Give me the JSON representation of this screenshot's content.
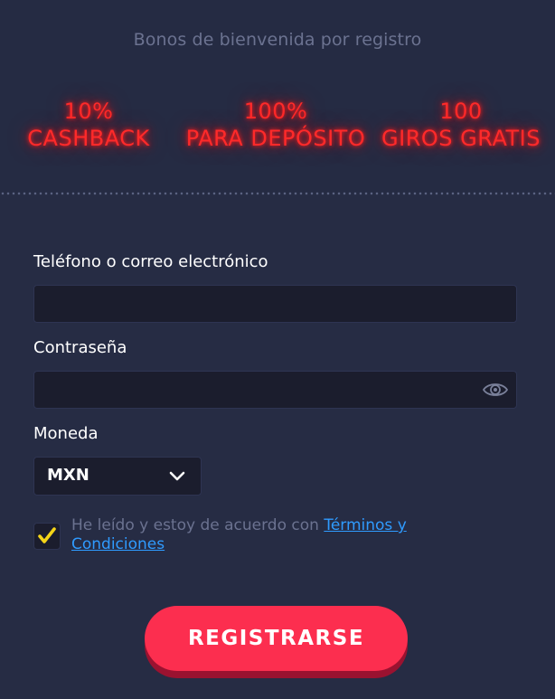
{
  "header": {
    "subtitle": "Bonos de bienvenida por registro"
  },
  "bonuses": [
    {
      "value": "10%",
      "label": "CASHBACK"
    },
    {
      "value": "100%",
      "label": "PARA DEPÓSITO"
    },
    {
      "value": "100",
      "label": "GIROS GRATIS"
    }
  ],
  "form": {
    "contact_label": "Teléfono o correo electrónico",
    "contact_value": "",
    "password_label": "Contraseña",
    "password_value": "",
    "currency_label": "Moneda",
    "currency_selected": "MXN",
    "terms_prefix": "He leído y estoy de acuerdo con ",
    "terms_link": "Términos y Condiciones",
    "terms_checked": true,
    "submit_label": "REGISTRARSE"
  },
  "colors": {
    "background": "#262c44",
    "neon_red": "#ff2a2a",
    "link_blue": "#2f9bff",
    "check_yellow": "#f5d518",
    "button_red": "#fc2e4f"
  },
  "icons": {
    "password_toggle": "eye-icon",
    "currency_dropdown": "chevron-down-icon",
    "checkbox": "checkmark-icon"
  }
}
